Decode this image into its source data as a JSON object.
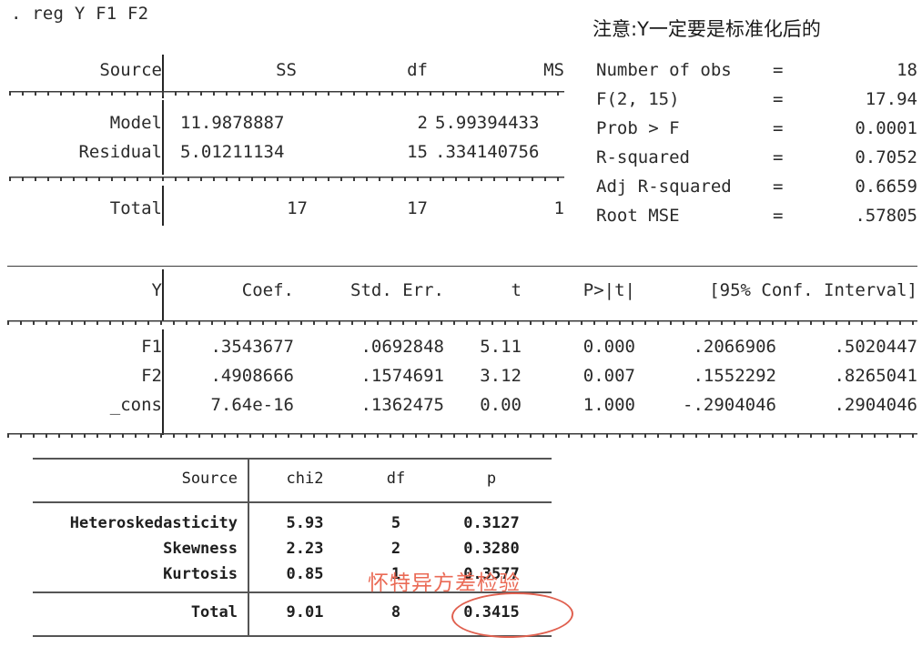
{
  "command": {
    "prompt": ". reg Y F1 F2"
  },
  "note_cn": "注意:Y一定要是标准化后的",
  "anova": {
    "headers": {
      "source": "Source",
      "ss": "SS",
      "df": "df",
      "ms": "MS"
    },
    "rows": [
      {
        "source": "Model",
        "ss": "11.9878887",
        "df": "2",
        "ms": "5.99394433"
      },
      {
        "source": "Residual",
        "ss": "5.01211134",
        "df": "15",
        "ms": ".334140756"
      }
    ],
    "total": {
      "source": "Total",
      "ss": "17",
      "df": "17",
      "ms": "1"
    }
  },
  "model_stats": [
    {
      "label": "Number of obs",
      "eq": "=",
      "value": "18"
    },
    {
      "label": "F(2, 15)",
      "eq": "=",
      "value": "17.94"
    },
    {
      "label": "Prob > F",
      "eq": "=",
      "value": "0.0001"
    },
    {
      "label": "R-squared",
      "eq": "=",
      "value": "0.7052"
    },
    {
      "label": "Adj R-squared",
      "eq": "=",
      "value": "0.6659"
    },
    {
      "label": "Root MSE",
      "eq": "=",
      "value": ".57805"
    }
  ],
  "coef_table": {
    "headers": {
      "depvar": "Y",
      "coef": "Coef.",
      "stderr": "Std. Err.",
      "t": "t",
      "p": "P>|t|",
      "ci": "[95% Conf. Interval]"
    },
    "rows": [
      {
        "term": "F1",
        "coef": ".3543677",
        "stderr": ".0692848",
        "t": "5.11",
        "p": "0.000",
        "ci_low": ".2066906",
        "ci_high": ".5020447"
      },
      {
        "term": "F2",
        "coef": ".4908666",
        "stderr": ".1574691",
        "t": "3.12",
        "p": "0.007",
        "ci_low": ".1552292",
        "ci_high": ".8265041"
      },
      {
        "term": "_cons",
        "coef": "7.64e-16",
        "stderr": ".1362475",
        "t": "0.00",
        "p": "1.000",
        "ci_low": "-.2904046",
        "ci_high": ".2904046"
      }
    ]
  },
  "white_test": {
    "headers": {
      "source": "Source",
      "chi2": "chi2",
      "df": "df",
      "p": "p"
    },
    "rows": [
      {
        "source": "Heteroskedasticity",
        "chi2": "5.93",
        "df": "5",
        "p": "0.3127"
      },
      {
        "source": "Skewness",
        "chi2": "2.23",
        "df": "2",
        "p": "0.3280"
      },
      {
        "source": "Kurtosis",
        "chi2": "0.85",
        "df": "1",
        "p": "0.3577"
      }
    ],
    "total": {
      "source": "Total",
      "chi2": "9.01",
      "df": "8",
      "p": "0.3415"
    }
  },
  "annotations": {
    "red_label": "怀特异方差检验",
    "red_color": "#ea6a55",
    "highlight_value": "0.3415"
  }
}
